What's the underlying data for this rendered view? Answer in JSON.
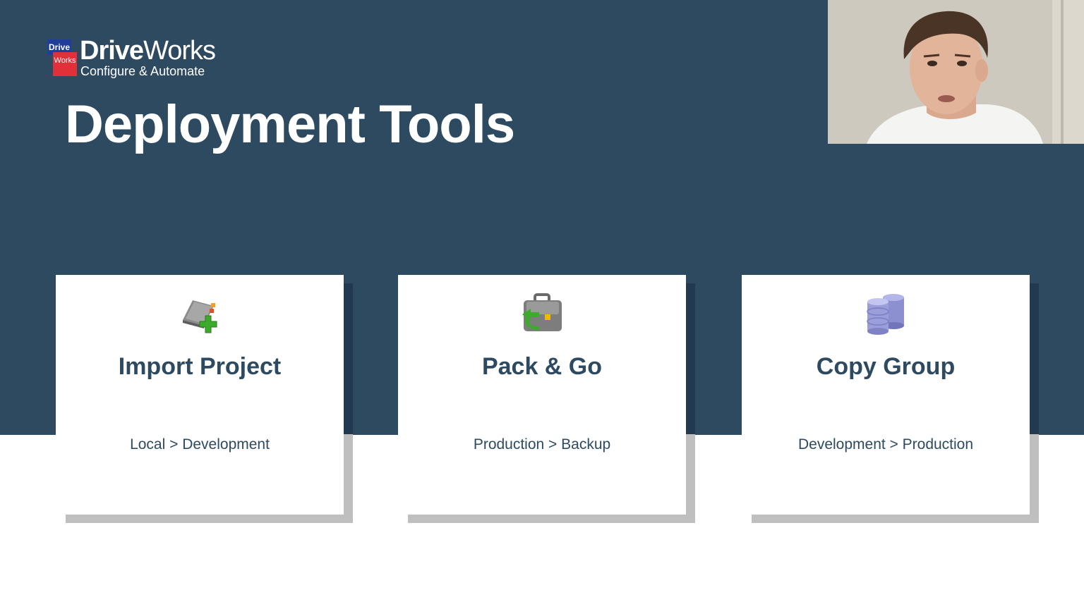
{
  "logo": {
    "badge_top": "Drive",
    "badge_bottom": "Works",
    "name_bold": "Drive",
    "name_regular": "Works",
    "tagline": "Configure & Automate"
  },
  "page": {
    "title": "Deployment Tools"
  },
  "colors": {
    "background_band": "#2e4a61",
    "card_text": "#2e4a61",
    "card_shadow": "#bfbfbf",
    "logo_blue": "#1e3e9a",
    "logo_red": "#e0303a"
  },
  "cards": [
    {
      "icon": "import-project-book-plus-icon",
      "title": "Import Project",
      "subtitle": "Local > Development"
    },
    {
      "icon": "pack-and-go-briefcase-icon",
      "title": "Pack & Go",
      "subtitle": "Production > Backup"
    },
    {
      "icon": "database-stack-icon",
      "title": "Copy Group",
      "subtitle": "Development > Production"
    }
  ],
  "webcam": {
    "icon": "presenter-video-feed"
  }
}
